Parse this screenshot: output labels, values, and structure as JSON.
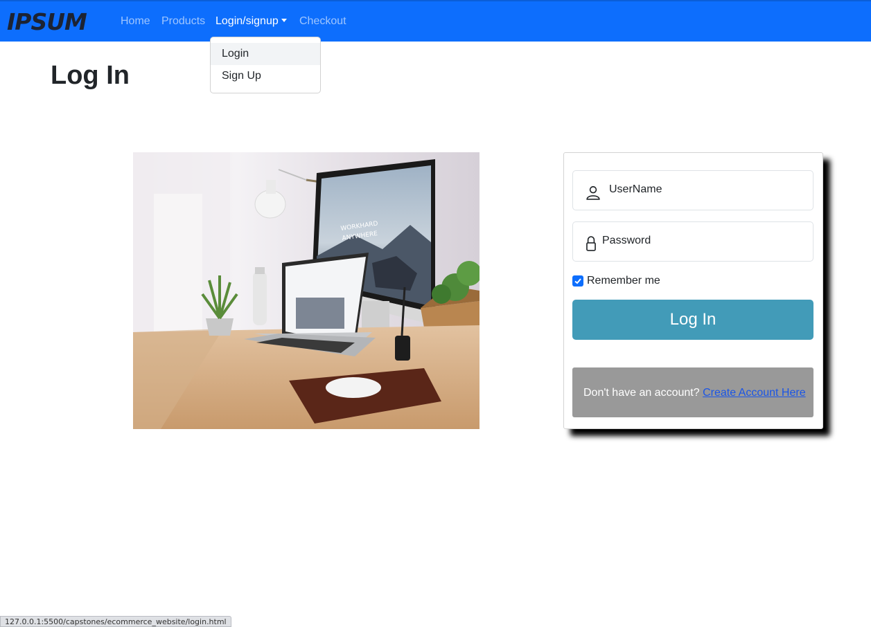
{
  "brand": {
    "logo_text": "IPSUM"
  },
  "nav": {
    "items": [
      {
        "label": "Home"
      },
      {
        "label": "Products"
      },
      {
        "label": "Login/signup"
      },
      {
        "label": "Checkout"
      }
    ],
    "active_index": 2
  },
  "dropdown": {
    "items": [
      {
        "label": "Login"
      },
      {
        "label": "Sign Up"
      }
    ],
    "hovered_index": 0
  },
  "page": {
    "title": "Log In"
  },
  "photo": {
    "screen_text_line1": "WORKHARD",
    "screen_text_line2": "ANYWHERE"
  },
  "form": {
    "username_placeholder": "UserName",
    "password_placeholder": "Password",
    "remember_label": "Remember me",
    "remember_checked": true,
    "login_button": "Log In",
    "no_account_text": "Don't have an account?",
    "create_account_link": "Create Account Here"
  },
  "status_bar": {
    "url": "127.0.0.1:5500/capstones/ecommerce_website/login.html"
  },
  "colors": {
    "navbar": "#0d6efd",
    "login_button": "#429bb8",
    "signup_box": "#999999",
    "link": "#1a55e6"
  }
}
